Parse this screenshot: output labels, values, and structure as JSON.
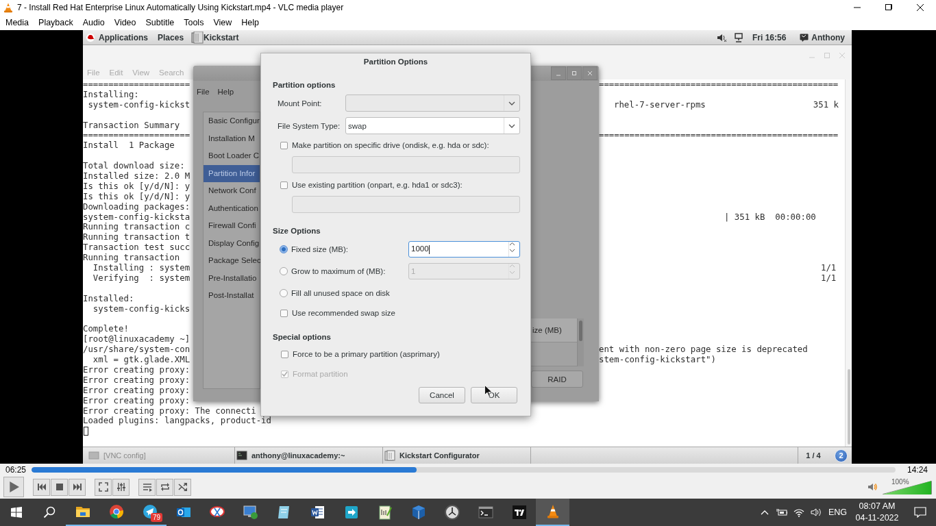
{
  "window": {
    "title": "7 - Install Red Hat Enterprise Linux Automatically Using Kickstart.mp4 - VLC media player"
  },
  "menu": [
    "Media",
    "Playback",
    "Audio",
    "Video",
    "Subtitle",
    "Tools",
    "View",
    "Help"
  ],
  "video": {
    "top_bar": {
      "menus": [
        "Applications",
        "Places",
        "Kickstart"
      ],
      "clock": "Fri 16:56",
      "user": "Anthony"
    },
    "terminal": {
      "menu": [
        "File",
        "Edit",
        "View",
        "Search"
      ],
      "lines": [
        {
          "text": "=====================",
          "right": [
            "==============================================="
          ]
        },
        {
          "text": "Installing:"
        },
        {
          "text": " system-config-kickst",
          "right": [
            "rhel-7-server-rpms",
            "351 k"
          ]
        },
        {
          "kind": "blank"
        },
        {
          "text": "Transaction Summary"
        },
        {
          "text": "=====================",
          "right": [
            "==============================================="
          ]
        },
        {
          "text": "Install  1 Package"
        },
        {
          "kind": "blank"
        },
        {
          "text": "Total download size:"
        },
        {
          "text": "Installed size: 2.0 M"
        },
        {
          "text": "Is this ok [y/d/N]: y"
        },
        {
          "text": "Is this ok [y/d/N]: y"
        },
        {
          "text": "Downloading packages:"
        },
        {
          "text": "system-config-kicksta",
          "right": [
            "| 351 kB  00:00:00"
          ]
        },
        {
          "text": "Running transaction c"
        },
        {
          "text": "Running transaction t"
        },
        {
          "text": "Transaction test succ"
        },
        {
          "text": "Running transaction"
        },
        {
          "text": "  Installing : system",
          "right": [
            "1/1"
          ]
        },
        {
          "text": "  Verifying  : system",
          "right": [
            "1/1"
          ]
        },
        {
          "kind": "blank"
        },
        {
          "text": "Installed:"
        },
        {
          "text": "  system-config-kicks"
        },
        {
          "kind": "blank"
        },
        {
          "text": "Complete!"
        },
        {
          "text": "[root@linuxacademy ~]"
        },
        {
          "text": "/usr/share/system-con",
          "right": [
            "ent with non-zero page size is deprecated"
          ]
        },
        {
          "text": "  xml = gtk.glade.XML",
          "right": [
            "stem-config-kickstart\")"
          ]
        },
        {
          "text": "Error creating proxy:"
        },
        {
          "text": "Error creating proxy:"
        },
        {
          "text": "Error creating proxy:"
        },
        {
          "text": "Error creating proxy:"
        },
        {
          "text": "Error creating proxy: The connecti"
        },
        {
          "text": "Loaded plugins: langpacks, product-id"
        }
      ]
    },
    "kickstart": {
      "menu": [
        "File",
        "Help"
      ],
      "sections": [
        {
          "label": "Basic Configur",
          "selected": false
        },
        {
          "label": "Installation M",
          "selected": false
        },
        {
          "label": "Boot Loader C",
          "selected": false
        },
        {
          "label": "Partition Infor",
          "selected": true
        },
        {
          "label": "Network Conf",
          "selected": false
        },
        {
          "label": "Authentication",
          "selected": false
        },
        {
          "label": "Firewall Confi",
          "selected": false
        },
        {
          "label": "Display Config",
          "selected": false
        },
        {
          "label": "Package Selec",
          "selected": false
        },
        {
          "label": "Pre-Installatio",
          "selected": false
        },
        {
          "label": "Post-Installat",
          "selected": false
        }
      ],
      "table_header": "ize (MB)",
      "buttons": [
        "RAID"
      ]
    },
    "dialog": {
      "title": "Partition Options",
      "partition": {
        "heading": "Partition options",
        "fields": [
          {
            "label": "Mount Point:",
            "disabled": true
          },
          {
            "label": "File System Type:",
            "value": "swap",
            "disabled": false
          }
        ],
        "checks": [
          {
            "label": "Make partition on specific drive (ondisk, e.g. hda or sdc):",
            "checked": false
          },
          {
            "label": "Use existing partition (onpart, e.g. hda1 or sdc3):",
            "checked": false
          }
        ]
      },
      "size": {
        "heading": "Size Options",
        "options": [
          {
            "kind": "radio",
            "label": "Fixed size (MB):",
            "selected": true,
            "spin": "1000"
          },
          {
            "kind": "radio",
            "label": "Grow to maximum of (MB):",
            "selected": false,
            "spin": "1"
          },
          {
            "kind": "radio",
            "label": "Fill all unused space on disk",
            "selected": false
          },
          {
            "kind": "checkbox",
            "label": "Use recommended swap size",
            "checked": false
          }
        ]
      },
      "special": {
        "heading": "Special options",
        "checks": [
          {
            "label": "Force to be a primary partition (asprimary)",
            "checked": false,
            "disabled": false
          },
          {
            "label": "Format partition",
            "checked": true,
            "disabled": true
          }
        ]
      },
      "buttons": [
        "Cancel",
        "OK"
      ]
    },
    "bottom_bar": {
      "tasks": [
        {
          "label": "[VNC config]",
          "minimized": true
        },
        {
          "label": "anthony@linuxacademy:~",
          "minimized": false
        },
        {
          "label": "Kickstart Configurator",
          "minimized": false
        }
      ],
      "workspace": "1 / 4",
      "badge": "2"
    }
  },
  "player": {
    "elapsed": "06:25",
    "level": 0.446,
    "duration": "14:24",
    "volume": {
      "reading": "100%",
      "level": 1.0
    }
  },
  "taskbar": {
    "apps": [
      {
        "running": true,
        "selected": false
      },
      {
        "running": true,
        "selected": false
      },
      {
        "running": true,
        "selected": false,
        "badge": "79"
      },
      {
        "running": false,
        "selected": false
      },
      {
        "running": false,
        "selected": false
      },
      {
        "running": false,
        "selected": false
      },
      {
        "running": false,
        "selected": false
      },
      {
        "running": false,
        "selected": false
      },
      {
        "running": false,
        "selected": false
      },
      {
        "running": false,
        "selected": false
      },
      {
        "running": false,
        "selected": false
      },
      {
        "running": false,
        "selected": false
      },
      {
        "running": false,
        "selected": false
      },
      {
        "running": false,
        "selected": false
      },
      {
        "running": true,
        "selected": true
      }
    ],
    "tray": {
      "language": "ENG",
      "time": "08:07 AM",
      "date": "04-11-2022"
    }
  }
}
